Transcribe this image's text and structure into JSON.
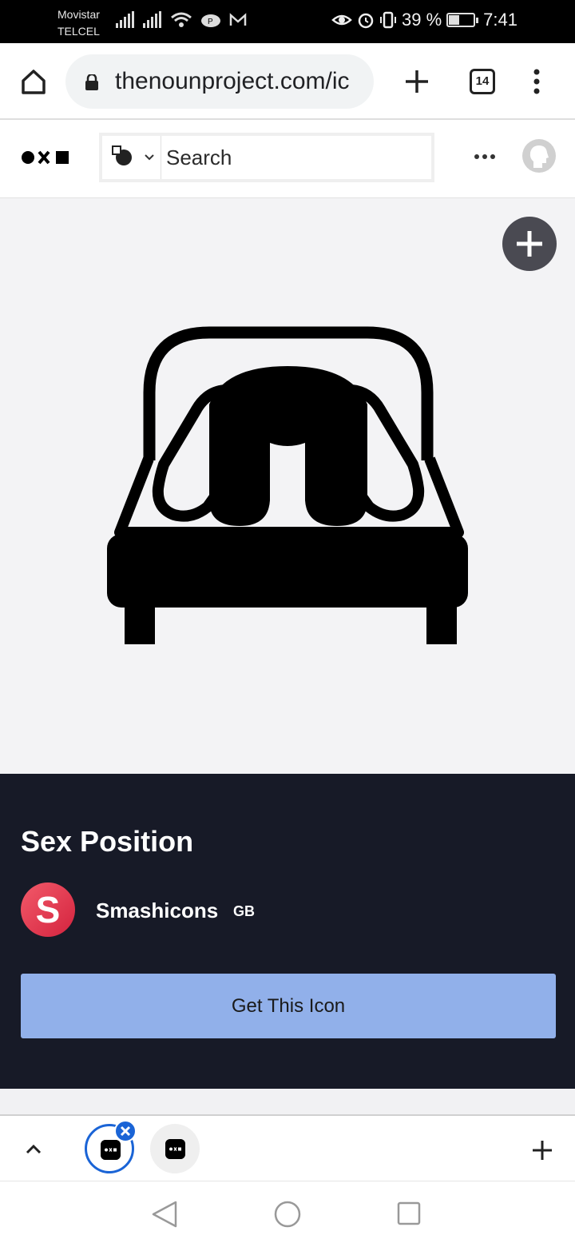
{
  "status_bar": {
    "carrier_line1": "Movistar",
    "carrier_line2": "TELCEL",
    "battery": "39 %",
    "battery_level": 0.39,
    "time": "7:41"
  },
  "browser": {
    "url": "thenounproject.com/ic",
    "tab_count": "14"
  },
  "site_header": {
    "search_placeholder": "Search"
  },
  "icon_detail": {
    "title": "Sex Position",
    "creator": {
      "initial": "S",
      "name": "Smashicons",
      "country": "GB"
    },
    "cta_label": "Get This Icon"
  },
  "colors": {
    "status_bar_bg": "#000000",
    "hero_bg": "#f3f3f5",
    "info_panel_bg": "#171a27",
    "cta_bg": "#91b0ea",
    "active_tab_ring": "#1a64d6",
    "creator_avatar": "#e2324a"
  },
  "icons": [
    "home-icon",
    "lock-icon",
    "plus-icon",
    "more-vert-icon",
    "noun-project-logo",
    "collection-type-icon",
    "chevron-down-icon",
    "more-horiz-icon",
    "user-avatar-icon",
    "add-icon",
    "bed-icon",
    "chevron-up-icon",
    "close-icon",
    "back-icon",
    "home-circle-icon",
    "recents-icon"
  ]
}
